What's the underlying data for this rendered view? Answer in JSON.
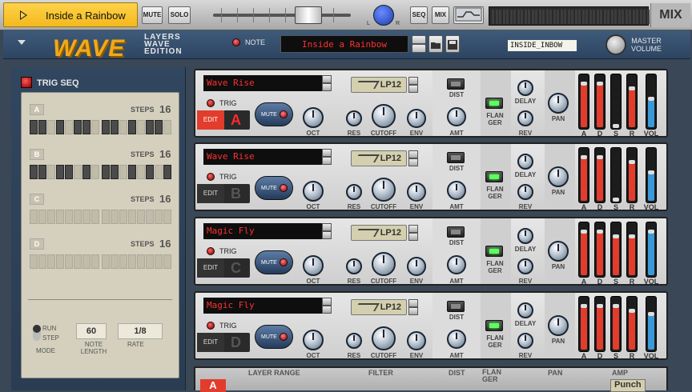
{
  "toolbar": {
    "patch_name": "Inside a Rainbow",
    "mute": "MUTE",
    "solo": "SOLO",
    "seq": "SEQ",
    "mix": "MIX",
    "mix_logo": "MIX"
  },
  "header": {
    "logo_text": "WAVE",
    "logo_sub1": "LAYERS",
    "logo_sub2": "WAVE",
    "logo_sub3": "EDITION",
    "note_label": "NOTE",
    "patch_display": "Inside a Rainbow",
    "tape_label": "INSIDE_INBOW",
    "master_volume_label1": "MASTER",
    "master_volume_label2": "VOLUME"
  },
  "sequencer": {
    "title": "TRIG SEQ",
    "steps_label": "STEPS",
    "rows": [
      {
        "id": "A",
        "steps": "16",
        "pattern": [
          1,
          1,
          0,
          1,
          0,
          1,
          1,
          0,
          1,
          1,
          0,
          1,
          0,
          1,
          1,
          0
        ]
      },
      {
        "id": "B",
        "steps": "16",
        "pattern": [
          1,
          1,
          0,
          1,
          1,
          0,
          1,
          0,
          1,
          1,
          0,
          1,
          0,
          1,
          0,
          1
        ]
      },
      {
        "id": "C",
        "steps": "16",
        "pattern": [
          0,
          0,
          0,
          0,
          0,
          0,
          0,
          0,
          0,
          0,
          0,
          0,
          0,
          0,
          0,
          0
        ]
      },
      {
        "id": "D",
        "steps": "16",
        "pattern": [
          0,
          0,
          0,
          0,
          0,
          0,
          0,
          0,
          0,
          0,
          0,
          0,
          0,
          0,
          0,
          0
        ]
      }
    ],
    "run_label": "RUN",
    "step_label": "STEP",
    "mode_label": "MODE",
    "note_length_value": "60",
    "note_length_label1": "NOTE",
    "note_length_label2": "LENGTH",
    "rate_value": "1/8",
    "rate_label": "RATE"
  },
  "layer_labels": {
    "trig": "TRIG",
    "edit": "EDIT",
    "mute": "MUTE",
    "oct": "OCT",
    "res": "RES",
    "cutoff": "CUTOFF",
    "env": "ENV",
    "dist": "DIST",
    "amt": "AMT",
    "flanger1": "FLAN",
    "flanger2": "GER",
    "delay": "DELAY",
    "rev": "REV",
    "pan": "PAN",
    "a": "A",
    "d": "D",
    "s": "S",
    "r": "R",
    "vol": "VOL"
  },
  "layers": [
    {
      "letter": "A",
      "wave": "Wave Rise",
      "filter": "LP12",
      "active": true,
      "adsr": [
        0.85,
        0.85,
        0.0,
        0.75
      ],
      "vol": 0.55
    },
    {
      "letter": "B",
      "wave": "Wave Rise",
      "filter": "LP12",
      "active": false,
      "adsr": [
        0.85,
        0.85,
        0.0,
        0.75
      ],
      "vol": 0.55
    },
    {
      "letter": "C",
      "wave": "Magic Fly",
      "filter": "LP12",
      "active": false,
      "adsr": [
        0.85,
        0.85,
        0.75,
        0.75
      ],
      "vol": 0.85
    },
    {
      "letter": "D",
      "wave": "Magic Fly",
      "filter": "LP12",
      "active": false,
      "adsr": [
        0.85,
        0.85,
        0.85,
        0.75
      ],
      "vol": 0.7
    }
  ],
  "bottom": {
    "layer_range": "LAYER RANGE",
    "filter": "FILTER",
    "dist": "DIST",
    "flanger": "FLAN GER",
    "pan": "PAN",
    "amp": "AMP",
    "letter": "A",
    "preset": "Punch"
  },
  "colors": {
    "accent": "#f3b91c",
    "red_led": "#ff3030",
    "fader_red": "#e23c2c",
    "fader_blue": "#3a9ad9"
  }
}
